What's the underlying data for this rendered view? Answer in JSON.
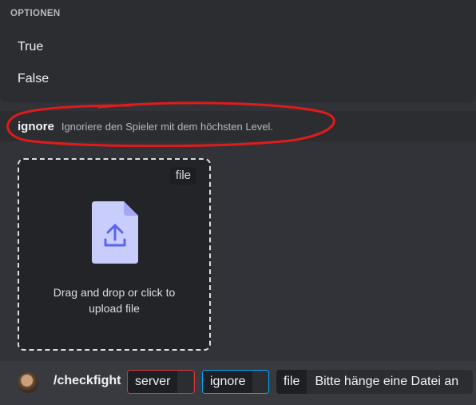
{
  "options": {
    "header": "OPTIONEN",
    "items": [
      {
        "label": "True"
      },
      {
        "label": "False"
      }
    ]
  },
  "hint": {
    "name": "ignore",
    "description": "Ignoriere den Spieler mit dem höchsten Level."
  },
  "upload": {
    "badge": "file",
    "text_line1": "Drag and drop or click to",
    "text_line2": "upload file",
    "icon": "upload-file-icon"
  },
  "command_bar": {
    "command": "/checkfight",
    "params": {
      "server": "server",
      "ignore": "ignore",
      "file": "file",
      "file_value": "Bitte hänge eine Datei an"
    }
  },
  "colors": {
    "background": "#313338",
    "popup": "#2b2d31",
    "annotation": "#e01b1b",
    "server_border": "#da373c",
    "ignore_border": "#00a8fc",
    "icon_fill": "#c9cdfb",
    "icon_accent": "#5865f2"
  }
}
